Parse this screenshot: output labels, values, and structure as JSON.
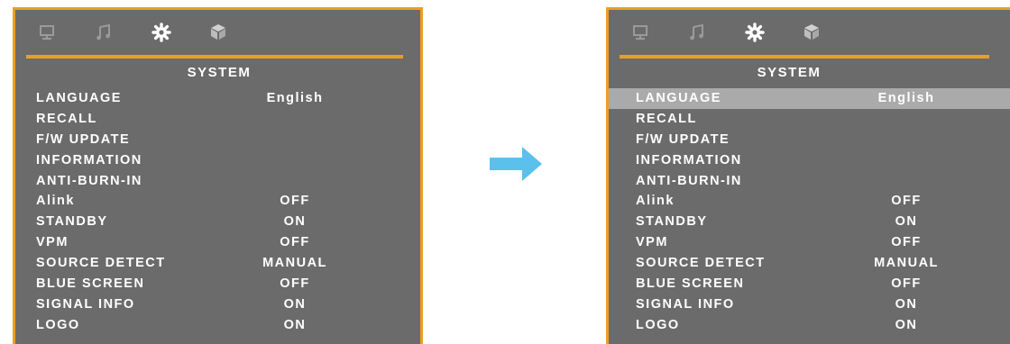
{
  "colors": {
    "panel_bg": "#6b6b6b",
    "accent": "#e8a021",
    "selected_row_bg": "#aaaaaa",
    "arrow": "#5bc0ec",
    "text": "#ffffff"
  },
  "tabs": [
    {
      "icon": "monitor-icon"
    },
    {
      "icon": "music-note-icon"
    },
    {
      "icon": "gear-icon",
      "active": true
    },
    {
      "icon": "cube-icon"
    }
  ],
  "left_menu": {
    "title": "SYSTEM",
    "rows": [
      {
        "label": "LANGUAGE",
        "value": "English"
      },
      {
        "label": "RECALL",
        "value": ""
      },
      {
        "label": "F/W UPDATE",
        "value": ""
      },
      {
        "label": "INFORMATION",
        "value": ""
      },
      {
        "label": "ANTI-BURN-IN",
        "value": ""
      },
      {
        "label": "Alink",
        "value": "OFF"
      },
      {
        "label": "STANDBY",
        "value": "ON"
      },
      {
        "label": "VPM",
        "value": "OFF"
      },
      {
        "label": "SOURCE DETECT",
        "value": "MANUAL"
      },
      {
        "label": "BLUE SCREEN",
        "value": "OFF"
      },
      {
        "label": "SIGNAL INFO",
        "value": "ON"
      },
      {
        "label": "LOGO",
        "value": "ON"
      }
    ]
  },
  "right_menu": {
    "title": "SYSTEM",
    "selected_item": "LANGUAGE",
    "rows": [
      {
        "label": "LANGUAGE",
        "value": "English"
      },
      {
        "label": "RECALL",
        "value": ""
      },
      {
        "label": "F/W UPDATE",
        "value": ""
      },
      {
        "label": "INFORMATION",
        "value": ""
      },
      {
        "label": "ANTI-BURN-IN",
        "value": ""
      },
      {
        "label": "Alink",
        "value": "OFF"
      },
      {
        "label": "STANDBY",
        "value": "ON"
      },
      {
        "label": "VPM",
        "value": "OFF"
      },
      {
        "label": "SOURCE DETECT",
        "value": "MANUAL"
      },
      {
        "label": "BLUE SCREEN",
        "value": "OFF"
      },
      {
        "label": "SIGNAL INFO",
        "value": "ON"
      },
      {
        "label": "LOGO",
        "value": "ON"
      }
    ]
  },
  "transition_arrow": {
    "icon": "arrow-right-icon"
  }
}
